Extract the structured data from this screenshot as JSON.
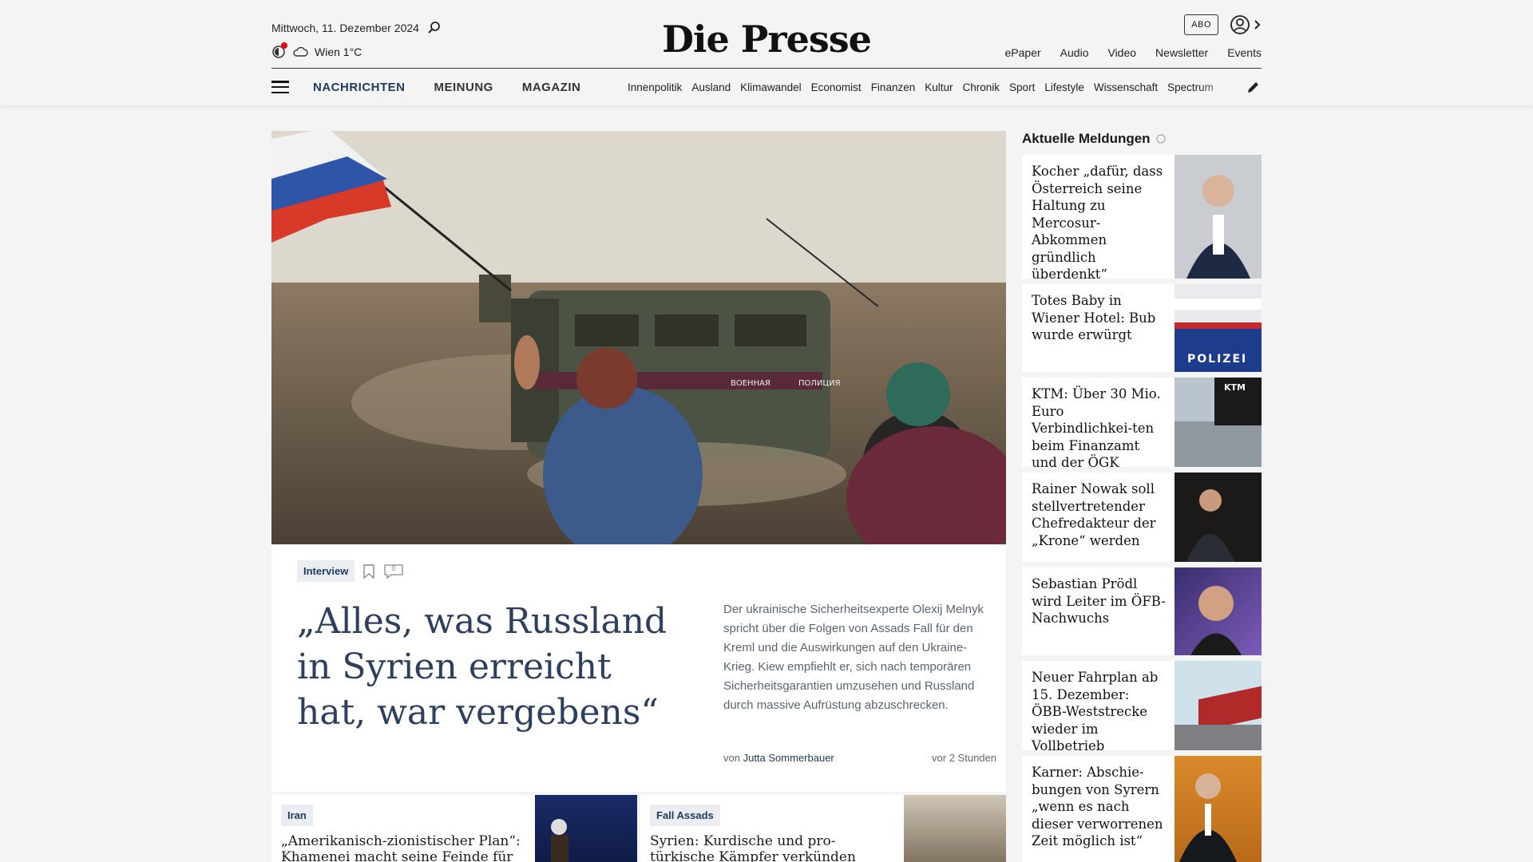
{
  "header": {
    "date": "Mittwoch, 11. Dezember 2024",
    "weather": "Wien 1°C",
    "logo": "Die Presse",
    "abo_label": "ABO",
    "quick_links": [
      "ePaper",
      "Audio",
      "Video",
      "Newsletter",
      "Events"
    ],
    "main_nav": [
      "NACHRICHTEN",
      "MEINUNG",
      "MAGAZIN"
    ],
    "sub_nav": [
      "Innenpolitik",
      "Ausland",
      "Klimawandel",
      "Economist",
      "Finanzen",
      "Kultur",
      "Chronik",
      "Sport",
      "Lifestyle",
      "Wissenschaft",
      "Spectrum"
    ]
  },
  "hero": {
    "tag": "Interview",
    "comment_count": "0",
    "title": "„Alles, was Russland in Syrien erreicht hat, war vergebens“",
    "teaser": "Der ukrainische Sicherheitsexperte Olexij Melnyk spricht über die Folgen von Assads Fall für den Kreml und die Auswirkungen auf den Ukraine-Krieg. Kiew empfiehlt er, sich nach temporären Sicherheitsgarantien umzusehen und Russland durch massive Aufrüstung abzuschrecken.",
    "byline_prefix": "von",
    "author": "Jutta Sommerbauer",
    "time_ago": "vor 2 Stunden",
    "vehicle_text_1": "ВОЕННАЯ",
    "vehicle_text_2": "ПОЛИЦИЯ"
  },
  "cards": [
    {
      "tag": "Iran",
      "title": "„Amerikanisch-zionistischer Plan“: Khamenei macht seine Feinde für den"
    },
    {
      "tag": "Fall Assads",
      "title": "Syrien: Kurdische und pro-türkische Kämpfer verkünden Waffenruhe"
    }
  ],
  "sidebar": {
    "heading": "Aktuelle Meldungen",
    "items": [
      {
        "title": "Kocher „dafür, dass Österreich seine Haltung zu Mercosur-Abkommen gründlich überdenkt“"
      },
      {
        "title": "Totes Baby in Wiener Hotel: Bub wurde erwürgt"
      },
      {
        "title": "KTM: Über 30 Mio. Euro Verbindlichkei-ten beim Finanzamt und der ÖGK"
      },
      {
        "title": "Rainer Nowak soll stellvertretender Chefredakteur der „Krone“ werden"
      },
      {
        "title": "Sebastian Prödl wird Leiter im ÖFB-Nachwuchs"
      },
      {
        "title": "Neuer Fahrplan ab 15. Dezember: ÖBB-Weststrecke wieder im Vollbetrieb"
      },
      {
        "title": "Karner: Abschie-bungen von Syrern „wenn es nach dieser verworrenen Zeit möglich ist“"
      }
    ],
    "police_label": "POLIZEI",
    "ktm_label": "KTM"
  },
  "colors": {
    "accent": "#1e3a5f",
    "title": "#2d3f5c",
    "alert_dot": "#e30613"
  }
}
